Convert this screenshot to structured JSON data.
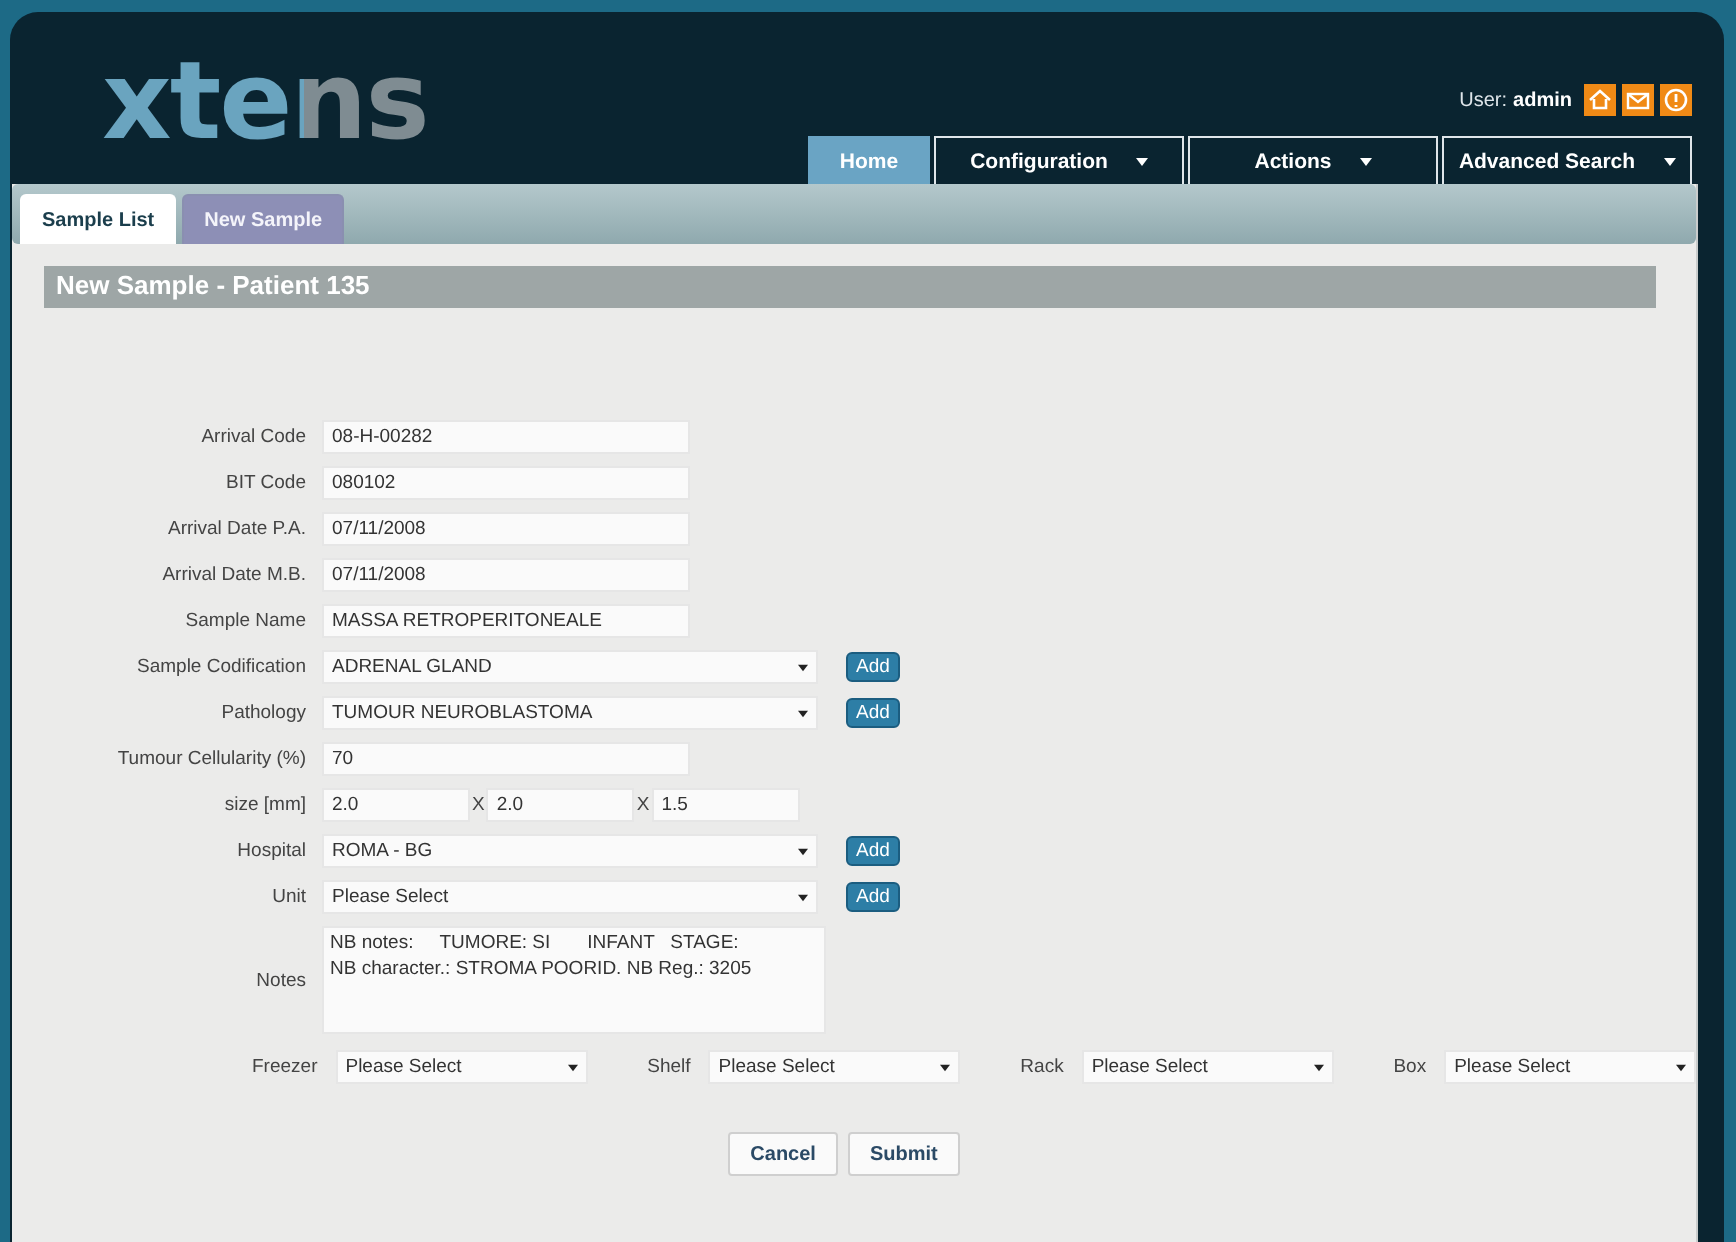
{
  "header": {
    "logo": "xtens",
    "user_label": "User:",
    "user_name": "admin"
  },
  "nav": [
    {
      "label": "Home",
      "selected": true,
      "has_menu": false
    },
    {
      "label": "Configuration",
      "selected": false,
      "has_menu": true
    },
    {
      "label": "Actions",
      "selected": false,
      "has_menu": true
    },
    {
      "label": "Advanced Search",
      "selected": false,
      "has_menu": true
    }
  ],
  "tabs": [
    {
      "label": "Sample List",
      "selected": true
    },
    {
      "label": "New Sample",
      "selected": false
    }
  ],
  "page_title": "New Sample - Patient 135",
  "fields": [
    {
      "kind": "text",
      "label": "Arrival Code",
      "value": "08-H-00282"
    },
    {
      "kind": "text",
      "label": "BIT Code",
      "value": "080102"
    },
    {
      "kind": "text",
      "label": "Arrival Date P.A.",
      "value": "07/11/2008"
    },
    {
      "kind": "text",
      "label": "Arrival Date M.B.",
      "value": "07/11/2008"
    },
    {
      "kind": "text",
      "label": "Sample Name",
      "value": "MASSA RETROPERITONEALE"
    },
    {
      "kind": "select",
      "label": "Sample Codification",
      "value": "ADRENAL GLAND",
      "button": "Add"
    },
    {
      "kind": "select",
      "label": "Pathology",
      "value": "TUMOUR NEUROBLASTOMA",
      "button": "Add"
    },
    {
      "kind": "text",
      "label": "Tumour Cellularity (%)",
      "value": "70"
    },
    {
      "kind": "size",
      "label": "size [mm]",
      "values": [
        "2.0",
        "2.0",
        "1.5"
      ],
      "separators": [
        "X",
        "X"
      ]
    },
    {
      "kind": "select",
      "label": "Hospital",
      "value": "ROMA - BG",
      "button": "Add"
    },
    {
      "kind": "select",
      "label": "Unit",
      "value": "Please Select",
      "button": "Add"
    },
    {
      "kind": "textarea",
      "label": "Notes",
      "value": "NB notes:     TUMORE: SI       INFANT   STAGE:\nNB character.: STROMA POORID. NB Reg.: 3205"
    }
  ],
  "storage": [
    {
      "label": "Freezer",
      "value": "Please Select"
    },
    {
      "label": "Shelf",
      "value": "Please Select"
    },
    {
      "label": "Rack",
      "value": "Please Select"
    },
    {
      "label": "Box",
      "value": "Please Select"
    }
  ],
  "buttons": [
    "Cancel",
    "Submit"
  ]
}
